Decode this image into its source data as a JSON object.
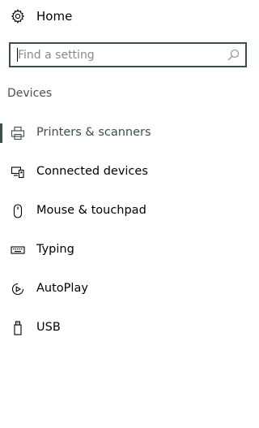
{
  "header": {
    "home_label": "Home",
    "home_icon": "gear-icon"
  },
  "search": {
    "placeholder": "Find a setting",
    "value": "",
    "icon": "search-icon"
  },
  "section": {
    "title": "Devices"
  },
  "nav": {
    "items": [
      {
        "label": "Printers & scanners",
        "icon": "printer-icon",
        "selected": true
      },
      {
        "label": "Connected devices",
        "icon": "connected-devices-icon",
        "selected": false
      },
      {
        "label": "Mouse & touchpad",
        "icon": "mouse-icon",
        "selected": false
      },
      {
        "label": "Typing",
        "icon": "keyboard-icon",
        "selected": false
      },
      {
        "label": "AutoPlay",
        "icon": "autoplay-icon",
        "selected": false
      },
      {
        "label": "USB",
        "icon": "usb-icon",
        "selected": false
      }
    ]
  },
  "colors": {
    "accent": "#3b4f4a",
    "section_title": "#505050",
    "placeholder": "#8a8a8a"
  }
}
